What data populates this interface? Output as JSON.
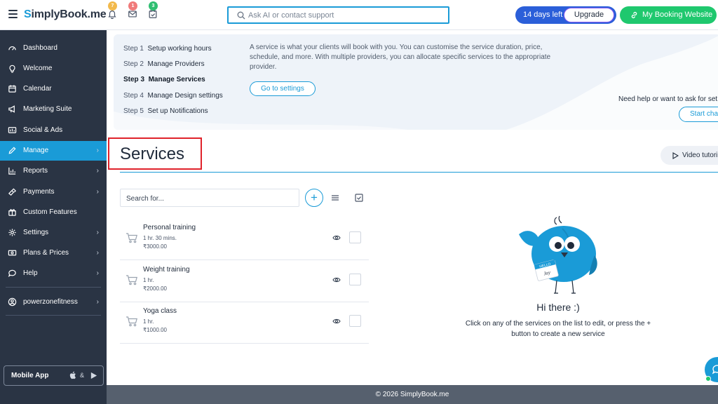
{
  "header": {
    "logo_text": "implyBook.me",
    "logo_s": "S",
    "notifications_badge": "7",
    "messages_badge": "1",
    "tasks_badge": "3",
    "search_placeholder": "Ask AI or contact support",
    "trial_days": "14 days left",
    "upgrade_label": "Upgrade",
    "booking_website_label": "My Booking Website"
  },
  "sidebar": {
    "items": [
      {
        "label": "Dashboard",
        "icon": "dashboard-icon"
      },
      {
        "label": "Welcome",
        "icon": "lightbulb-icon"
      },
      {
        "label": "Calendar",
        "icon": "calendar-icon"
      },
      {
        "label": "Marketing Suite",
        "icon": "megaphone-icon"
      },
      {
        "label": "Social & Ads",
        "icon": "social-ads-icon"
      },
      {
        "label": "Manage",
        "icon": "pencil-icon"
      },
      {
        "label": "Reports",
        "icon": "chart-icon"
      },
      {
        "label": "Payments",
        "icon": "payments-icon"
      },
      {
        "label": "Custom Features",
        "icon": "gift-icon"
      },
      {
        "label": "Settings",
        "icon": "gear-icon"
      },
      {
        "label": "Plans & Prices",
        "icon": "money-icon"
      },
      {
        "label": "Help",
        "icon": "help-chat-icon"
      }
    ],
    "account": "powerzonefitness",
    "mobile_app_label": "Mobile App",
    "mobile_app_amp": "&"
  },
  "setup": {
    "steps": [
      {
        "num": "Step 1",
        "label": "Setup working hours"
      },
      {
        "num": "Step 2",
        "label": "Manage Providers"
      },
      {
        "num": "Step 3",
        "label": "Manage Services"
      },
      {
        "num": "Step 4",
        "label": "Manage Design settings"
      },
      {
        "num": "Step 5",
        "label": "Set up Notifications"
      }
    ],
    "description": "A service is what your clients will book with you. You can customise the service duration, price, schedule, and more. With multiple providers, you can allocate specific services to the appropriate provider.",
    "goto_label": "Go to settings",
    "help_text": "Need help or want to ask for set",
    "start_chat_label": "Start cha"
  },
  "page": {
    "title": "Services",
    "video_label": "Video tutori",
    "search_placeholder": "Search for...",
    "add_label": "+"
  },
  "services": [
    {
      "name": "Personal training",
      "duration": "1 hr. 30 mins.",
      "price": "₹3000.00"
    },
    {
      "name": "Weight training",
      "duration": "1 hr.",
      "price": "₹2000.00"
    },
    {
      "name": "Yoga class",
      "duration": "1 hr.",
      "price": "₹1000.00"
    }
  ],
  "empty_state": {
    "title": "Hi there :)",
    "hint": "Click on any of the services on the list to edit, or press the + button to create a new service",
    "badge_hello": "HELLO",
    "badge_name": "Jay"
  },
  "footer": "© 2026 SimplyBook.me",
  "colors": {
    "sidebar_bg": "#2a3444",
    "accent": "#1a9bd7",
    "green": "#1fc86e",
    "trial_blue": "#2b5fd9",
    "highlight_red": "#e0222b"
  }
}
